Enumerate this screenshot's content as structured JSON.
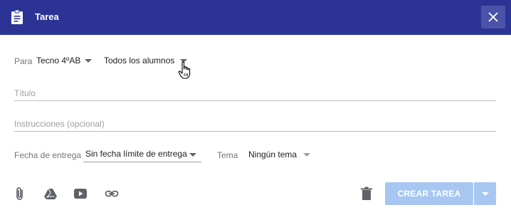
{
  "header": {
    "title": "Tarea",
    "icon": "assignment-icon",
    "close_icon": "close-icon",
    "bg_color": "#2b3494"
  },
  "recipients": {
    "label": "Para",
    "class_value": "Tecno 4ºAB",
    "students_value": "Todos los alumnos"
  },
  "form": {
    "title_placeholder": "Título",
    "instructions_placeholder": "Instrucciones (opcional)"
  },
  "details": {
    "due_label": "Fecha de entrega",
    "due_value": "Sin fecha límite de entrega",
    "topic_label": "Tema",
    "topic_value": "Ningún tema"
  },
  "toolbar": {
    "icons": [
      "attach-icon",
      "drive-icon",
      "youtube-icon",
      "link-icon",
      "trash-icon"
    ]
  },
  "actions": {
    "create_label": "CREAR TAREA",
    "button_color": "#a7c7f2"
  }
}
